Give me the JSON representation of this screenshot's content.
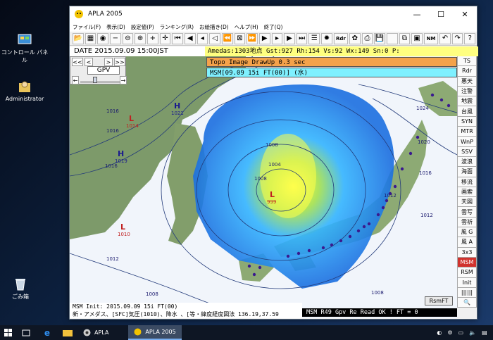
{
  "desktop": {
    "icons": [
      {
        "label": "コントロール パネル",
        "icon": "control-panel-icon"
      },
      {
        "label": "Administrator",
        "icon": "user-folder-icon"
      },
      {
        "label": "ごみ箱",
        "icon": "recycle-bin-icon"
      }
    ]
  },
  "window": {
    "title": "APLA 2005",
    "controls": {
      "minimize": "—",
      "maximize": "☐",
      "close": "✕"
    }
  },
  "menu": [
    "ファイル(F)",
    "表示(D)",
    "設定値(P)",
    "ランキング(R)",
    "お絵描き(D)",
    "ヘルプ(H)",
    "終了(Q)"
  ],
  "toolbar": {
    "buttons": [
      {
        "name": "open-icon",
        "glyph": "📂"
      },
      {
        "name": "calendar-icon",
        "glyph": "▦"
      },
      {
        "name": "globe-icon",
        "glyph": "◉"
      },
      {
        "name": "zoom-out-icon",
        "glyph": "−"
      },
      {
        "name": "zoom-out-circle-icon",
        "glyph": "⊖"
      },
      {
        "name": "zoom-in-circle-icon",
        "glyph": "⊕"
      },
      {
        "name": "plus-icon",
        "glyph": "+"
      },
      {
        "name": "crosshair-icon",
        "glyph": "✛"
      },
      {
        "name": "first-frame-icon",
        "glyph": "⏮"
      },
      {
        "name": "prev-frame-icon",
        "glyph": "◀"
      },
      {
        "name": "step-back-icon",
        "glyph": "◂"
      },
      {
        "name": "play-back-icon",
        "glyph": "◁"
      },
      {
        "name": "back-fast-icon",
        "glyph": "⏪"
      },
      {
        "name": "fit-icon",
        "glyph": "⊠"
      },
      {
        "name": "fast-forward-icon",
        "glyph": "⏩"
      },
      {
        "name": "play-icon",
        "glyph": "▶"
      },
      {
        "name": "step-forward-icon",
        "glyph": "▸"
      },
      {
        "name": "next-frame-icon",
        "glyph": "▶"
      },
      {
        "name": "last-frame-icon",
        "glyph": "⏭"
      },
      {
        "name": "list-icon",
        "glyph": "☰"
      },
      {
        "name": "settings-gear-icon",
        "glyph": "✹"
      },
      {
        "name": "radar-button",
        "glyph": "Rdr"
      },
      {
        "name": "fan-icon",
        "glyph": "✿"
      },
      {
        "name": "print-icon",
        "glyph": "⎙"
      },
      {
        "name": "save-icon",
        "glyph": "💾"
      },
      {
        "name": "blank-icon",
        "glyph": " "
      },
      {
        "name": "copy-icon",
        "glyph": "⧉"
      },
      {
        "name": "image-icon",
        "glyph": "▣"
      },
      {
        "name": "nm-button",
        "glyph": "NM"
      },
      {
        "name": "undo-icon",
        "glyph": "↶"
      },
      {
        "name": "redo-icon",
        "glyph": "↷"
      },
      {
        "name": "help-icon",
        "glyph": "?"
      }
    ]
  },
  "info": {
    "date": "DATE 2015.09.09  15:00JST",
    "amedas": "Amedas:1303地点  Gst:927 Rh:154 Vs:92 Wx:149 Sn:0 P:"
  },
  "map": {
    "topo_message": "Topo Image DrawUp 0.3 sec",
    "msm_message": "MSM[09.09 15i FT(00)] (水)",
    "nav": {
      "prev_fast": "<<",
      "prev": "<",
      "next": ">",
      "next_fast": ">>",
      "gpv_label": "GPV",
      "arrow_left": "←",
      "arrow_right": "→"
    },
    "pressure_labels": [
      {
        "text": "1016",
        "color": "#1a1a6e"
      },
      {
        "text": "1016",
        "color": "#1a1a6e"
      },
      {
        "text": "1016",
        "color": "#1a1a6e"
      },
      {
        "text": "1012",
        "color": "#1a1a6e"
      },
      {
        "text": "1008",
        "color": "#1a1a6e"
      },
      {
        "text": "1004",
        "color": "#1a1a6e"
      },
      {
        "text": "1024",
        "color": "#1a1a6e"
      },
      {
        "text": "1020",
        "color": "#1a1a6e"
      },
      {
        "text": "1016",
        "color": "#1a1a6e"
      },
      {
        "text": "1012",
        "color": "#1a1a6e"
      },
      {
        "text": "1012",
        "color": "#1a1a6e"
      },
      {
        "text": "1008",
        "color": "#1a1a6e"
      },
      {
        "text": "1008",
        "color": "#1a1a6e"
      },
      {
        "text": "1008",
        "color": "#1a1a6e"
      }
    ],
    "systems": [
      {
        "type": "H",
        "value": "1021",
        "color": "#1a1a8e"
      },
      {
        "type": "L",
        "value": "1014",
        "color": "#c02020"
      },
      {
        "type": "H",
        "value": "1019",
        "color": "#1a1a8e"
      },
      {
        "type": "L",
        "value": "1010",
        "color": "#c02020"
      },
      {
        "type": "L",
        "value": "999",
        "color": "#c02020"
      }
    ],
    "rsmft_label": "RsmFT",
    "status_line1": "MSM Init: 2015.09.09 15i FT(00)",
    "status_line2": "新・アメダス、[SFC]気圧(1010)、降水 、[等・緯度経度図法 136.19,37.59",
    "status_right": "MSM R49 Gpv Re Read OK !  FT = 0"
  },
  "sidebar": [
    {
      "label": "TS",
      "active": false
    },
    {
      "label": "Rdr",
      "active": false
    },
    {
      "label": "悪天",
      "active": false
    },
    {
      "label": "注警",
      "active": false
    },
    {
      "label": "地震",
      "active": false
    },
    {
      "label": "台風",
      "active": false
    },
    {
      "label": "SYN",
      "active": false
    },
    {
      "label": "MTR",
      "active": false
    },
    {
      "label": "WnP",
      "active": false
    },
    {
      "label": "SSV",
      "active": false
    },
    {
      "label": "波浪",
      "active": false
    },
    {
      "label": "海面",
      "active": false
    },
    {
      "label": "移流",
      "active": false
    },
    {
      "label": "画索",
      "active": false
    },
    {
      "label": "天図",
      "active": false
    },
    {
      "label": "雲写",
      "active": false
    },
    {
      "label": "雲祈",
      "active": false
    },
    {
      "label": "風 G",
      "active": false
    },
    {
      "label": "風 A",
      "active": false
    },
    {
      "label": "3x3",
      "active": false
    },
    {
      "label": "MSM",
      "active": true
    },
    {
      "label": "RSM",
      "active": false
    },
    {
      "label": "Init",
      "active": false
    },
    {
      "label": "||||||",
      "active": false
    },
    {
      "label": "🔍",
      "active": false
    }
  ],
  "taskbar": {
    "apps": [
      {
        "label": "APLA",
        "icon": "apla-chrome-icon",
        "active": false
      },
      {
        "label": "APLA 2005",
        "icon": "apla-app-icon",
        "active": true
      }
    ]
  }
}
